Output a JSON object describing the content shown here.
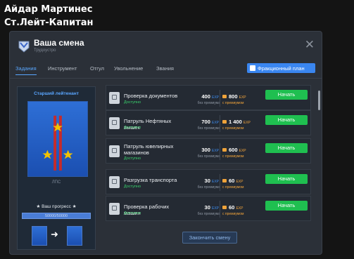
{
  "player": {
    "name": "Айдар Мартинес",
    "rank": "Ст.Лейт-Капитан"
  },
  "modal": {
    "title": "Ваша смена",
    "subtitle": "Трудоустро",
    "tabs": [
      {
        "label": "Задания",
        "active": true
      },
      {
        "label": "Инструмент",
        "active": false
      },
      {
        "label": "Отгул",
        "active": false
      },
      {
        "label": "Увольнение",
        "active": false
      },
      {
        "label": "Звания",
        "active": false
      }
    ],
    "faction_button": "Фракционный план",
    "finish_button": "Закончить смену"
  },
  "profile": {
    "rank_title": "Старший лейтенант",
    "org": "ЛПС",
    "progress_label": "★ Ваш прогресс ★",
    "progress_text": "50000/50000",
    "progress_fraction": 1.0
  },
  "tasks": [
    {
      "name": "Проверка документов",
      "status": "Доступно",
      "exp": "400",
      "exp_unit": "EXP",
      "exp_note": "без премиума",
      "premium": "800",
      "premium_unit": "EXP",
      "premium_note": "с премиумом",
      "button": "Начать",
      "icon": "document-check-icon"
    },
    {
      "name": "Патруль Нефтяных вышек",
      "status": "Доступно",
      "exp": "700",
      "exp_unit": "EXP",
      "exp_note": "без премиума",
      "premium": "1 400",
      "premium_unit": "EXP",
      "premium_note": "с премиумом",
      "button": "Начать",
      "icon": "oil-tower-icon"
    },
    {
      "name": "Патруль ювелирных магазинов",
      "status": "Доступно",
      "exp": "300",
      "exp_unit": "EXP",
      "exp_note": "без премиума",
      "premium": "600",
      "premium_unit": "EXP",
      "premium_note": "с премиумом",
      "button": "Начать",
      "icon": "diamond-icon"
    },
    {
      "name": "Разгрузка транспорта",
      "status": "Доступно",
      "exp": "30",
      "exp_unit": "EXP",
      "exp_note": "без премиума",
      "premium": "60",
      "premium_unit": "EXP",
      "premium_note": "с премиумом",
      "button": "Начать",
      "icon": "forklift-icon"
    },
    {
      "name": "Проверка рабочих машин",
      "status": "Доступно",
      "exp": "30",
      "exp_unit": "EXP",
      "exp_note": "без премиума",
      "premium": "60",
      "premium_unit": "EXP",
      "premium_note": "с премиумом",
      "button": "Начать",
      "icon": "car-icon"
    }
  ],
  "colors": {
    "accent": "#59a7ff",
    "start_button": "#1fbf50",
    "status_green": "#39d36c",
    "premium": "#f0a33a"
  }
}
